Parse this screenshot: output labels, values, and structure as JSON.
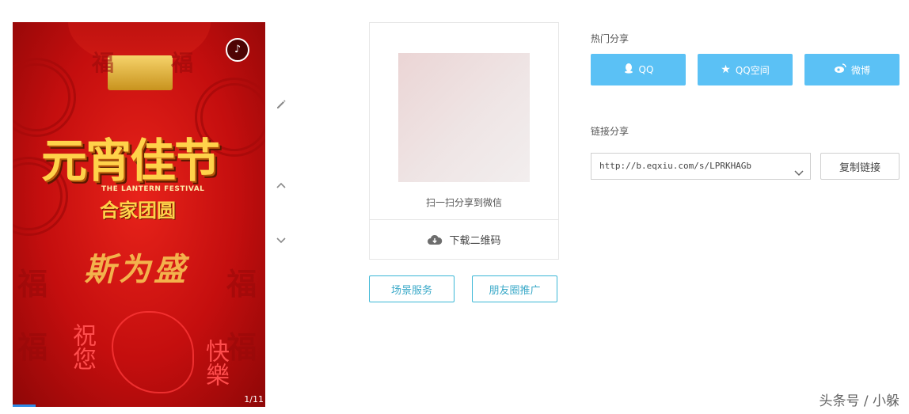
{
  "preview": {
    "title": "元宵佳节",
    "title_en": "THE LANTERN FESTIVAL",
    "subtitle": "合家团圆",
    "author": "斯为盛",
    "greeting_left": "祝您",
    "greeting_right": "快樂",
    "page_indicator": "1/11",
    "progress_fraction": 0.09,
    "fu_char": "福"
  },
  "qr": {
    "caption": "扫一扫分享到微信",
    "download_label": "下载二维码"
  },
  "actions": {
    "scene_service": "场景服务",
    "moments_promo": "朋友圈推广"
  },
  "share": {
    "hot_label": "热门分享",
    "qq": "QQ",
    "qzone": "QQ空间",
    "weibo": "微博",
    "link_label": "链接分享",
    "link_value": "http://b.eqxiu.com/s/LPRKHAGb",
    "copy_label": "复制链接"
  },
  "watermark": "头条号 / 小躲",
  "colors": {
    "share_blue": "#5bc1f5",
    "outline_teal": "#3bb7d6",
    "festival_red": "#c40e0e",
    "gold": "#ffd24a"
  }
}
